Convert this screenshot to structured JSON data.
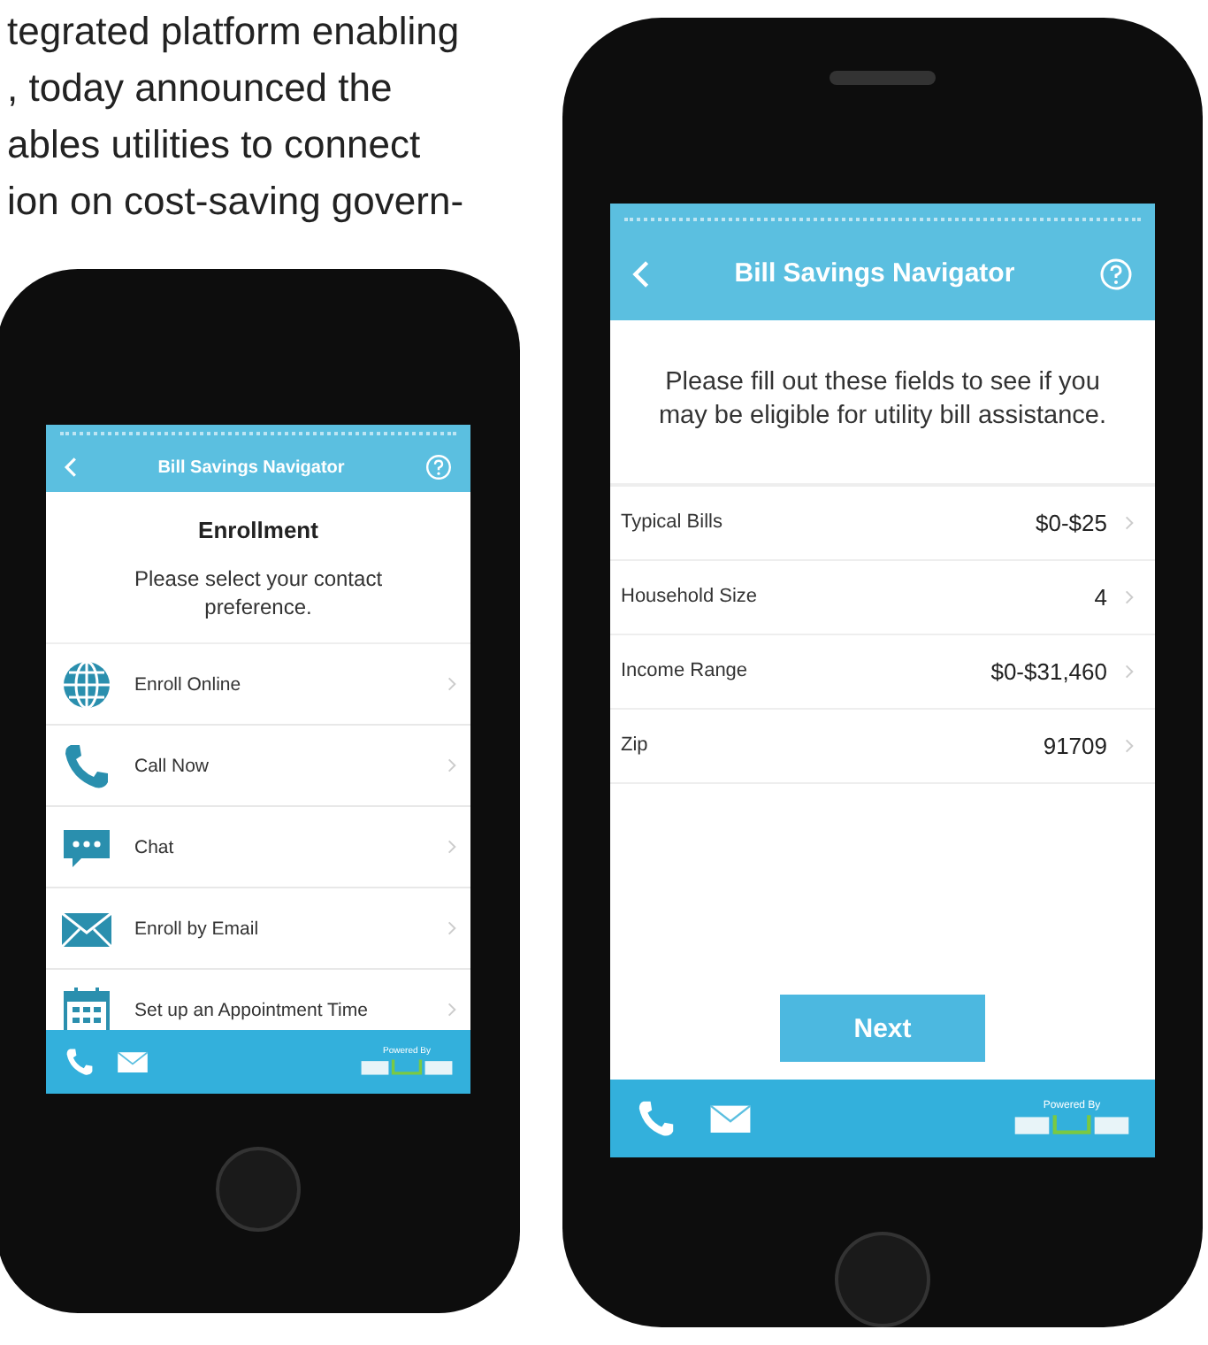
{
  "intro_lines": [
    "tegrated platform enabling",
    ", today announced the",
    "ables utilities to connect",
    "ion on cost-saving govern-"
  ],
  "enrollment_phone": {
    "nav_title": "Bill Savings Navigator",
    "heading": "Enrollment",
    "prompt": "Please select your contact preference.",
    "options": [
      {
        "kind": "globe",
        "label": "Enroll Online"
      },
      {
        "kind": "phone",
        "label": "Call Now"
      },
      {
        "kind": "chat",
        "label": "Chat"
      },
      {
        "kind": "mail",
        "label": "Enroll by Email"
      },
      {
        "kind": "calendar",
        "label": "Set up an Appointment Time"
      }
    ],
    "powered_by": "Powered By"
  },
  "eligibility_phone": {
    "nav_title": "Bill Savings Navigator",
    "prompt": "Please fill out these fields to see if you may be eligible for utility bill assistance.",
    "fields": [
      {
        "label": "Typical Bills",
        "value": "$0-$25"
      },
      {
        "label": "Household Size",
        "value": "4"
      },
      {
        "label": "Income Range",
        "value": "$0-$31,460"
      },
      {
        "label": "Zip",
        "value": "91709"
      }
    ],
    "next_button": "Next",
    "powered_by": "Powered By"
  }
}
